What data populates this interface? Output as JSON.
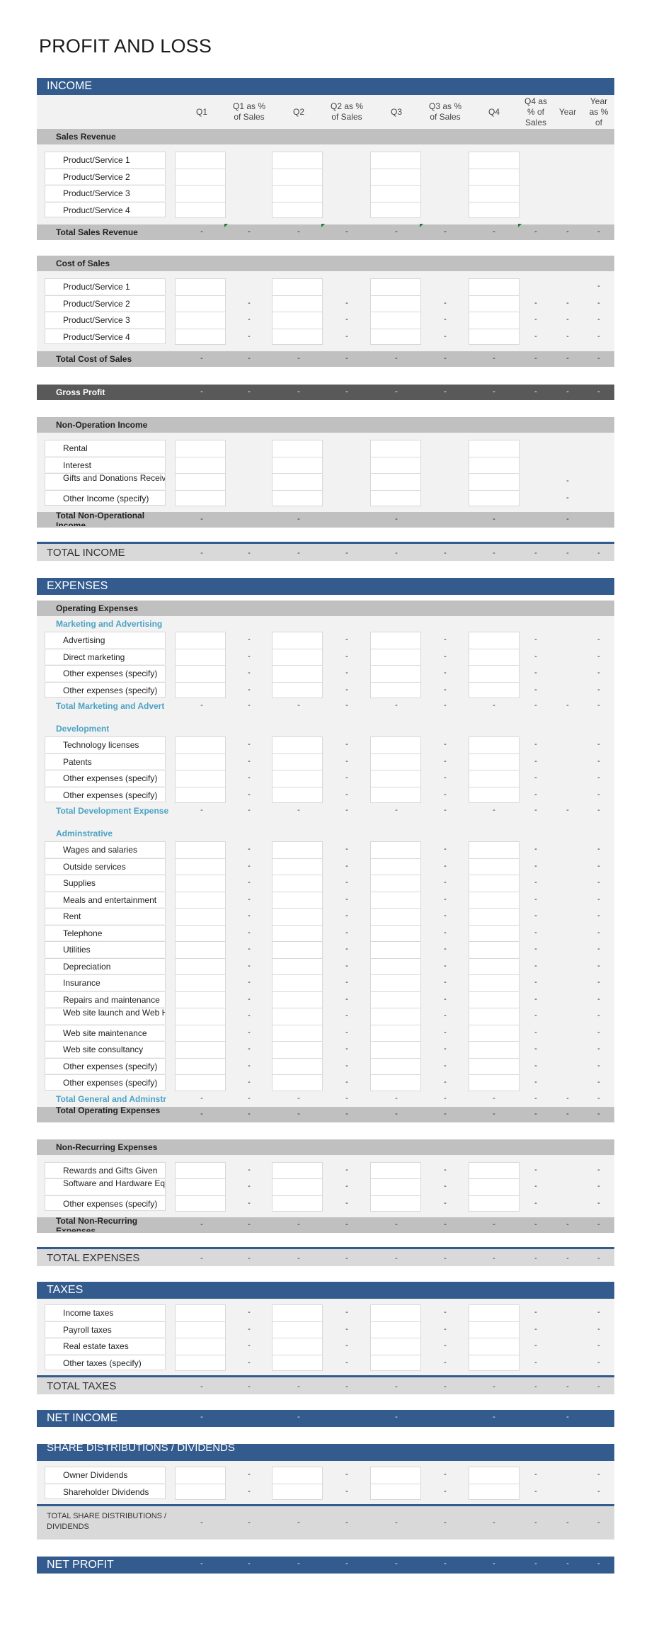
{
  "title": "PROFIT AND LOSS",
  "dash": "-",
  "columns": [
    "Q1",
    "Q1 as % of Sales",
    "Q2",
    "Q2 as % of Sales",
    "Q3",
    "Q3 as % of Sales",
    "Q4",
    "Q4 as % of Sales",
    "Year",
    "Year as % of"
  ],
  "income": {
    "header": "INCOME",
    "sales_revenue": {
      "label": "Sales Revenue",
      "items": [
        "Product/Service 1",
        "Product/Service 2",
        "Product/Service 3",
        "Product/Service 4"
      ],
      "total_label": "Total Sales Revenue"
    },
    "cost_of_sales": {
      "label": "Cost of Sales",
      "items": [
        "Product/Service 1",
        "Product/Service 2",
        "Product/Service 3",
        "Product/Service 4"
      ],
      "total_label": "Total Cost of Sales"
    },
    "gross_profit": "Gross Profit",
    "non_operation": {
      "label": "Non-Operation Income",
      "items": [
        "Rental",
        "Interest",
        "Gifts and Donations Received",
        "Other Income (specify)"
      ],
      "total_label": "Total Non-Operational Income"
    },
    "total_label": "TOTAL INCOME"
  },
  "expenses": {
    "header": "EXPENSES",
    "operating": {
      "label": "Operating Expenses",
      "marketing": {
        "label": "Marketing and Advertising",
        "items": [
          "Advertising",
          "Direct marketing",
          "Other expenses (specify)",
          "Other expenses (specify)"
        ],
        "total_label": "Total Marketing and Advert"
      },
      "development": {
        "label": "Development",
        "items": [
          "Technology licenses",
          "Patents",
          "Other expenses (specify)",
          "Other expenses (specify)"
        ],
        "total_label": "Total Development Expense"
      },
      "administrative": {
        "label": "Adminstrative",
        "items": [
          "Wages and salaries",
          "Outside services",
          "Supplies",
          "Meals and entertainment",
          "Rent",
          "Telephone",
          "Utilities",
          "Depreciation",
          "Insurance",
          "Repairs and maintenance",
          "Web site launch and Web Hosting",
          "Web site maintenance",
          "Web site consultancy",
          "Other expenses (specify)",
          "Other expenses (specify)"
        ],
        "total_label": "Total General and Adminstr"
      },
      "total_label": "Total Operating Expenses"
    },
    "non_recurring": {
      "label": "Non-Recurring Expenses",
      "items": [
        "Rewards and Gifts Given",
        "Software and Hardware Equipments",
        "Other expenses (specify)"
      ],
      "total_label": "Total Non-Recurring Expenses"
    },
    "total_label": "TOTAL EXPENSES"
  },
  "taxes": {
    "header": "TAXES",
    "items": [
      "Income taxes",
      "Payroll taxes",
      "Real estate taxes",
      "Other taxes (specify)"
    ],
    "total_label": "TOTAL TAXES"
  },
  "net_income": "NET INCOME",
  "share": {
    "header": "SHARE DISTRIBUTIONS / DIVIDENDS",
    "items": [
      "Owner Dividends",
      "Shareholder Dividends"
    ],
    "total_label": "TOTAL SHARE DISTRIBUTIONS / DIVIDENDS"
  },
  "net_profit": "NET PROFIT"
}
